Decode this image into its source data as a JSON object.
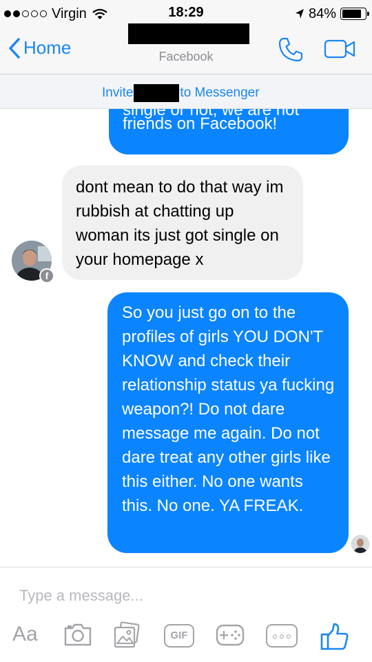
{
  "status_bar": {
    "carrier": "Virgin",
    "time": "18:29",
    "battery": "84%",
    "signal_bars_filled": 2,
    "signal_bars_total": 5
  },
  "nav": {
    "back_label": "Home",
    "subtitle": "Facebook",
    "call_icon": "phone-icon",
    "video_icon": "video-camera-icon"
  },
  "invite": {
    "prefix": "Invite",
    "suffix": "to Messenger"
  },
  "messages": [
    {
      "direction": "sent",
      "cut_line": "single or not, we are not",
      "text": "friends on Facebook!"
    },
    {
      "direction": "received",
      "text": "dont mean to do that way im rubbish at chatting up woman its just got single on your homepage x"
    },
    {
      "direction": "sent",
      "text": "So you just go on to the profiles of girls YOU DON'T KNOW and check their relationship status ya fucking weapon?! Do not dare message me again. Do not dare treat any other girls like this either. No one wants this. No one. YA FREAK."
    }
  ],
  "composer": {
    "placeholder": "Type a message...",
    "aa_label": "Aa",
    "gif_label": "GIF"
  },
  "colors": {
    "accent": "#1a86f2",
    "sent_bubble": "#0b84ff",
    "received_bubble": "#f0f0f0",
    "toolbar_icon": "#a3a3a8"
  }
}
